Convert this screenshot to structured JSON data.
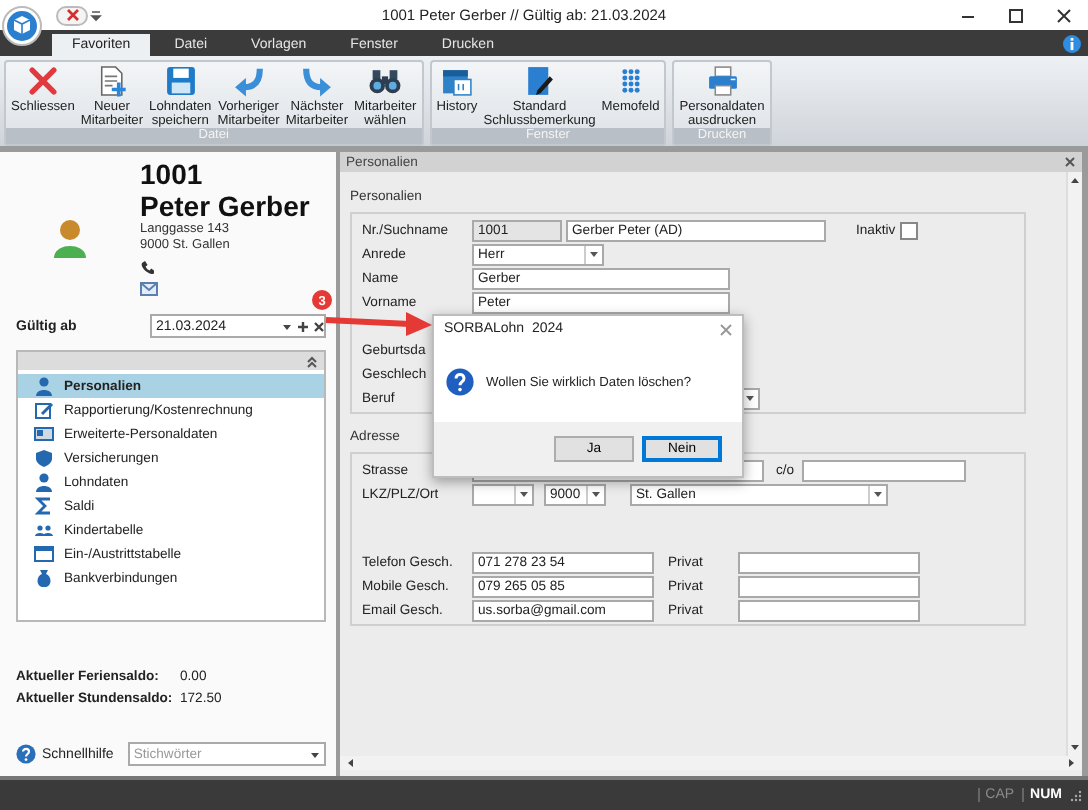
{
  "window": {
    "title": "1001 Peter Gerber // Gültig ab: 21.03.2024"
  },
  "tabs": [
    {
      "label": "Favoriten",
      "selected": true
    },
    {
      "label": "Datei",
      "selected": false
    },
    {
      "label": "Vorlagen",
      "selected": false
    },
    {
      "label": "Fenster",
      "selected": false
    },
    {
      "label": "Drucken",
      "selected": false
    }
  ],
  "ribbon": {
    "groups": [
      {
        "title": "Datei",
        "buttons": [
          {
            "label": "Schliessen",
            "kind": "close"
          },
          {
            "label": "Neuer\nMitarbeiter",
            "kind": "new"
          },
          {
            "label": "Lohndaten\nspeichern",
            "kind": "save"
          },
          {
            "label": "Vorheriger\nMitarbeiter",
            "kind": "back"
          },
          {
            "label": "Nächster\nMitarbeiter",
            "kind": "forward"
          },
          {
            "label": "Mitarbeiter\nwählen",
            "kind": "find"
          }
        ]
      },
      {
        "title": "Fenster",
        "buttons": [
          {
            "label": "History",
            "kind": "calendar"
          },
          {
            "label": "Standard\nSchlussbemerkung",
            "kind": "note"
          },
          {
            "label": "Memofeld",
            "kind": "memo"
          }
        ]
      },
      {
        "title": "Drucken",
        "buttons": [
          {
            "label": "Personaldaten\nausdrucken",
            "kind": "print"
          }
        ]
      }
    ]
  },
  "employee": {
    "number": "1001",
    "name": "Peter Gerber",
    "street": "Langgasse 143",
    "city": "9000 St. Gallen"
  },
  "valid_from": {
    "label": "Gültig ab",
    "value": "21.03.2024"
  },
  "nav": {
    "items": [
      {
        "label": "Personalien",
        "kind": "person",
        "selected": true
      },
      {
        "label": "Rapportierung/Kostenrechnung",
        "kind": "report",
        "selected": false
      },
      {
        "label": "Erweiterte-Personaldaten",
        "kind": "card",
        "selected": false
      },
      {
        "label": "Versicherungen",
        "kind": "shield",
        "selected": false
      },
      {
        "label": "Lohndaten",
        "kind": "person",
        "selected": false
      },
      {
        "label": "Saldi",
        "kind": "sigma",
        "selected": false
      },
      {
        "label": "Kindertabelle",
        "kind": "kids",
        "selected": false
      },
      {
        "label": "Ein-/Austrittstabelle",
        "kind": "table",
        "selected": false
      },
      {
        "label": "Bankverbindungen",
        "kind": "bank",
        "selected": false
      }
    ]
  },
  "balances": [
    {
      "label": "Aktueller Feriensaldo:",
      "value": "0.00"
    },
    {
      "label": "Aktueller Stundensaldo:",
      "value": "172.50"
    }
  ],
  "quick_help": {
    "label": "Schnellhilfe",
    "placeholder": "Stichwörter"
  },
  "panel": {
    "title": "Personalien",
    "sections": [
      {
        "title": "Personalien",
        "rows": [
          {
            "label": "Nr./Suchname",
            "fields": [
              {
                "kind": "readonly",
                "value": "1001"
              },
              {
                "kind": "text",
                "value": "Gerber Peter (AD)"
              },
              {
                "kind": "label",
                "value": "Inaktiv"
              },
              {
                "kind": "checkbox",
                "checked": false
              }
            ]
          },
          {
            "label": "Anrede",
            "fields": [
              {
                "kind": "select",
                "value": "Herr"
              }
            ]
          },
          {
            "label": "Name",
            "fields": [
              {
                "kind": "text",
                "value": "Gerber"
              }
            ]
          },
          {
            "label": "Vorname",
            "fields": [
              {
                "kind": "text",
                "value": "Peter"
              }
            ]
          },
          {
            "label": "Geburtsda",
            "fields": []
          },
          {
            "label": "Geschlech",
            "fields": []
          },
          {
            "label": "Beruf",
            "fields": [
              {
                "kind": "select"
              }
            ]
          }
        ]
      },
      {
        "title": "Adresse",
        "rows": [
          {
            "label": "Strasse",
            "fields": [
              {
                "kind": "text"
              },
              {
                "kind": "label",
                "value": "c/o"
              },
              {
                "kind": "text"
              }
            ]
          },
          {
            "label": "LKZ/PLZ/Ort",
            "fields": [
              {
                "kind": "select"
              },
              {
                "kind": "select",
                "value": "9000"
              },
              {
                "kind": "select",
                "value": "St. Gallen"
              }
            ]
          },
          {
            "label": "Telefon Gesch.",
            "fields": [
              {
                "kind": "text",
                "value": "071 278 23 54"
              },
              {
                "kind": "label",
                "value": "Privat"
              },
              {
                "kind": "text"
              }
            ]
          },
          {
            "label": "Mobile Gesch.",
            "fields": [
              {
                "kind": "text",
                "value": "079 265 05 85"
              },
              {
                "kind": "label",
                "value": "Privat"
              },
              {
                "kind": "text"
              }
            ]
          },
          {
            "label": "Email Gesch.",
            "fields": [
              {
                "kind": "text",
                "value": "us.sorba@gmail.com"
              },
              {
                "kind": "label",
                "value": "Privat"
              },
              {
                "kind": "text"
              }
            ]
          }
        ]
      }
    ]
  },
  "dialog": {
    "title": "SORBALohn  2024",
    "message": "Wollen Sie wirklich Daten löschen?",
    "buttons": [
      {
        "label": "Ja",
        "selected": false
      },
      {
        "label": "Nein",
        "selected": true
      }
    ]
  },
  "annotation": {
    "badge": "3"
  },
  "status_bar": {
    "indicators": [
      {
        "label": "CAP",
        "on": false
      },
      {
        "label": "NUM",
        "on": true
      }
    ]
  }
}
